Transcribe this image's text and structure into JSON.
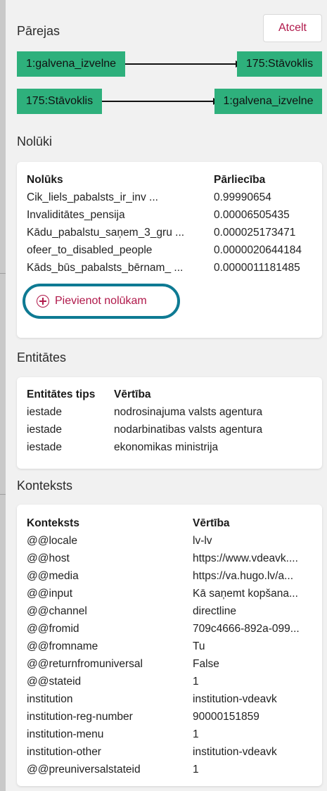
{
  "transitions": {
    "title": "Pārejas",
    "cancel_label": "Atcelt",
    "edges": [
      {
        "from": "1:galvena_izvelne",
        "to": "175:Stāvoklis"
      },
      {
        "from": "175:Stāvoklis",
        "to": "1:galvena_izvelne"
      }
    ]
  },
  "intents": {
    "title": "Nolūki",
    "col_intent": "Nolūks",
    "col_confidence": "Pārliecība",
    "rows": [
      {
        "intent": "Cik_liels_pabalsts_ir_inv ...",
        "confidence": "0.99990654"
      },
      {
        "intent": "Invaliditātes_pensija",
        "confidence": "0.00006505435"
      },
      {
        "intent": "Kādu_pabalstu_saņem_3_gru ...",
        "confidence": "0.000025173471"
      },
      {
        "intent": "ofeer_to_disabled_people",
        "confidence": "0.0000020644184"
      },
      {
        "intent": "Kāds_būs_pabalsts_bērnam_ ...",
        "confidence": "0.0000011181485"
      }
    ],
    "add_label": "Pievienot nolūkam"
  },
  "entities": {
    "title": "Entitātes",
    "col_type": "Entitātes tips",
    "col_value": "Vērtība",
    "rows": [
      {
        "type": "iestade",
        "value": "nodrosinajuma valsts agentura"
      },
      {
        "type": "iestade",
        "value": "nodarbinatibas valsts agentura"
      },
      {
        "type": "iestade",
        "value": "ekonomikas ministrija"
      }
    ]
  },
  "context": {
    "title": "Konteksts",
    "col_key": "Konteksts",
    "col_value": "Vērtība",
    "rows": [
      {
        "key": "@@locale",
        "value": "lv-lv"
      },
      {
        "key": "@@host",
        "value": "https://www.vdeavk...."
      },
      {
        "key": "@@media",
        "value": "https://va.hugo.lv/a..."
      },
      {
        "key": "@@input",
        "value": "Kā saņemt kopšana..."
      },
      {
        "key": "@@channel",
        "value": "directline"
      },
      {
        "key": "@@fromid",
        "value": "709c4666-892a-099..."
      },
      {
        "key": "@@fromname",
        "value": "Tu"
      },
      {
        "key": "@@returnfromuniversal",
        "value": "False"
      },
      {
        "key": "@@stateid",
        "value": "1"
      },
      {
        "key": "institution",
        "value": "institution-vdeavk"
      },
      {
        "key": "institution-reg-number",
        "value": "90000151859"
      },
      {
        "key": "institution-menu",
        "value": "1"
      },
      {
        "key": "institution-other",
        "value": "institution-vdeavk"
      },
      {
        "key": "@@preuniversalstateid",
        "value": "1"
      }
    ]
  }
}
